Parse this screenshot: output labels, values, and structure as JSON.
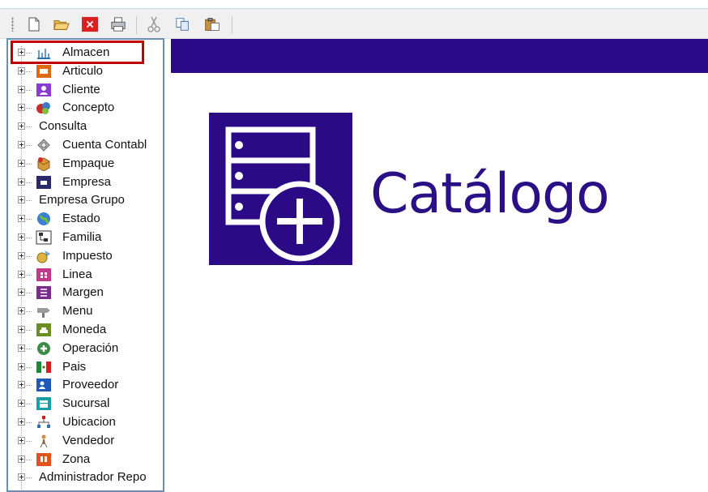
{
  "toolbar": {
    "buttons": [
      {
        "name": "new-icon"
      },
      {
        "name": "open-folder-icon"
      },
      {
        "name": "delete-icon"
      },
      {
        "name": "print-icon"
      },
      {
        "name": "cut-icon"
      },
      {
        "name": "copy-icon"
      },
      {
        "name": "paste-icon"
      }
    ]
  },
  "tree": {
    "items": [
      {
        "label": "Almacen",
        "icon": "warehouse-icon",
        "selected": true
      },
      {
        "label": "Articulo",
        "icon": "article-icon"
      },
      {
        "label": "Cliente",
        "icon": "client-icon"
      },
      {
        "label": "Concepto",
        "icon": "concept-icon"
      },
      {
        "label": "Consulta",
        "icon": null
      },
      {
        "label": "Cuenta Contabl",
        "icon": "accounting-account-icon"
      },
      {
        "label": "Empaque",
        "icon": "packaging-icon"
      },
      {
        "label": "Empresa",
        "icon": "company-icon"
      },
      {
        "label": "Empresa Grupo",
        "icon": null
      },
      {
        "label": "Estado",
        "icon": "state-globe-icon"
      },
      {
        "label": "Familia",
        "icon": "family-tree-icon"
      },
      {
        "label": "Impuesto",
        "icon": "tax-icon"
      },
      {
        "label": "Linea",
        "icon": "line-icon"
      },
      {
        "label": "Margen",
        "icon": "margin-icon"
      },
      {
        "label": "Menu",
        "icon": "menu-icon"
      },
      {
        "label": "Moneda",
        "icon": "currency-icon"
      },
      {
        "label": "Operación",
        "icon": "operation-icon"
      },
      {
        "label": "Pais",
        "icon": "country-flag-icon"
      },
      {
        "label": "Proveedor",
        "icon": "supplier-icon"
      },
      {
        "label": "Sucursal",
        "icon": "branch-store-icon"
      },
      {
        "label": "Ubicacion",
        "icon": "location-icon"
      },
      {
        "label": "Vendedor",
        "icon": "seller-icon"
      },
      {
        "label": "Zona",
        "icon": "zone-icon"
      },
      {
        "label": "Administrador Repo",
        "icon": null
      }
    ]
  },
  "main": {
    "title": "Catálogo",
    "icon": "catalog-add-icon",
    "accent_color": "#2a0a86"
  },
  "colors": {
    "highlight": "#c00000",
    "tree_border": "#6e8fb4"
  }
}
